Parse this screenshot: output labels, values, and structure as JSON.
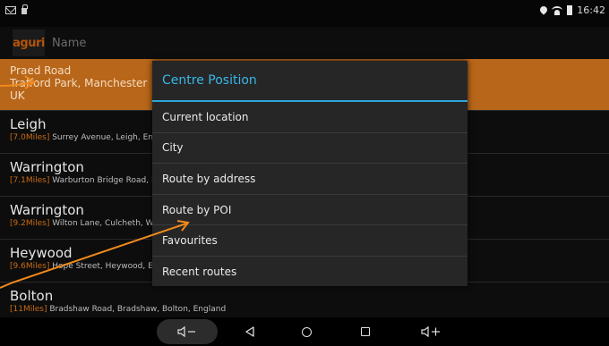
{
  "status_bar": {
    "time": "16:42"
  },
  "search": {
    "logo_text": "aguri",
    "placeholder": "Name"
  },
  "list": {
    "selected": {
      "line1": "Praed Road",
      "line2": "Trafford Park, Manchester",
      "line3": "UK"
    },
    "items": [
      {
        "title": "Leigh",
        "distance": "[7.0Miles]",
        "address": "Surrey Avenue, Leigh, Eng"
      },
      {
        "title": "Warrington",
        "distance": "[7.1Miles]",
        "address": "Warburton Bridge Road, I"
      },
      {
        "title": "Warrington",
        "distance": "[9.2Miles]",
        "address": "Wilton Lane, Culcheth, W"
      },
      {
        "title": "Heywood",
        "distance": "[9.6Miles]",
        "address": "Hope Street, Heywood, En"
      },
      {
        "title": "Bolton",
        "distance": "[11Miles]",
        "address": "Bradshaw Road, Bradshaw, Bolton, England"
      }
    ]
  },
  "dialog": {
    "title": "Centre Position",
    "items": [
      "Current location",
      "City",
      "Route by address",
      "Route by POI",
      "Favourites",
      "Recent routes"
    ]
  },
  "colors": {
    "accent": "#39b7e8",
    "selected_row": "#b7661a",
    "distance": "#c96b14",
    "arrow": "#f08a1c"
  }
}
